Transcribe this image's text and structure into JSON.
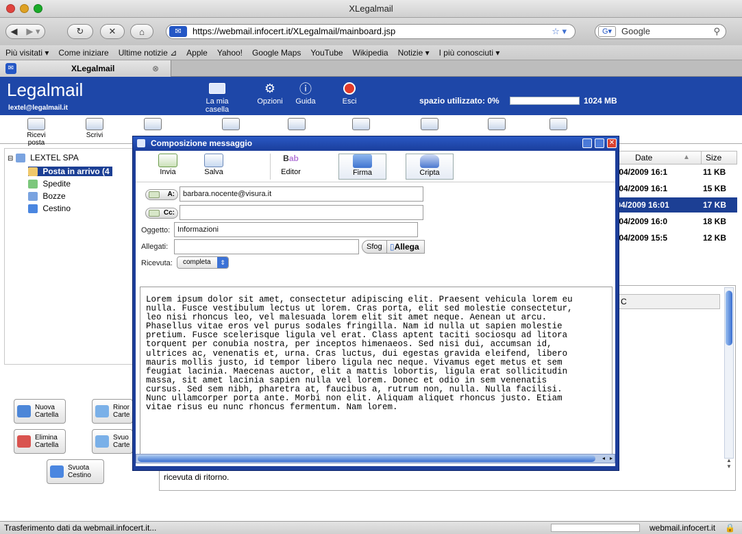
{
  "window": {
    "title": "XLegalmail"
  },
  "browser": {
    "url": "https://webmail.infocert.it/XLegalmail/mainboard.jsp",
    "search_placeholder": "Google",
    "bookmarks": [
      "Più visitati ▾",
      "Come iniziare",
      "Ultime notizie ⊿",
      "Apple",
      "Yahoo!",
      "Google Maps",
      "YouTube",
      "Wikipedia",
      "Notizie ▾",
      "I più conosciuti ▾"
    ],
    "tab_label": "XLegalmail",
    "status_text": "Trasferimento dati da webmail.infocert.it...",
    "status_domain": "webmail.infocert.it"
  },
  "app": {
    "logo": "Legalmail",
    "user": "lextel@legalmail.it",
    "header_buttons": [
      "La mia casella",
      "Opzioni",
      "Guida",
      "Esci"
    ],
    "usage_label": "spazio utilizzato: 0%",
    "usage_fraction": 0.0,
    "usage_max": "1024 MB",
    "toolbar": [
      "Ricevi posta",
      "Scrivi"
    ],
    "tree": {
      "root": "LEXTEL SPA",
      "items": [
        "Posta in arrivo (4",
        "Spedite",
        "Bozze",
        "Cestino"
      ]
    },
    "folder_buttons": {
      "new": [
        "Nuova",
        "Cartella"
      ],
      "rename": [
        "Rinor",
        "Carte"
      ],
      "delete": [
        "Elimina",
        "Cartella"
      ],
      "empty": [
        "Svuo",
        "Carte"
      ],
      "trash": [
        "Svuota",
        "Cestino"
      ]
    },
    "list": {
      "col_date": "Date",
      "col_size": "Size",
      "rows": [
        {
          "date": ")/04/2009 16:1",
          "size": "11 KB"
        },
        {
          "date": ")/04/2009 16:1",
          "size": "15 KB"
        },
        {
          "date": "/04/2009 16:01",
          "size": "17 KB"
        },
        {
          "date": ")/04/2009 16:0",
          "size": "18 KB"
        },
        {
          "date": ")/04/2009 15:5",
          "size": "12 KB"
        }
      ],
      "preview_fragment": "C",
      "preview_bottom": "ricevuta di ritorno."
    }
  },
  "dialog": {
    "title": "Composizione messaggio",
    "buttons": [
      "Invia",
      "Salva",
      "Editor",
      "Firma",
      "Cripta"
    ],
    "to_label": "A:",
    "to_value": "barbara.nocente@visura.it",
    "cc_label": "Cc:",
    "cc_value": "",
    "subject_label": "Oggetto:",
    "subject_value": "Informazioni",
    "attach_label": "Allegati:",
    "browse_label": "Sfog",
    "attach_button": "Allega",
    "receipt_label": "Ricevuta:",
    "receipt_value": "completa",
    "body": "Lorem ipsum dolor sit amet, consectetur adipiscing elit. Praesent vehicula lorem eu\nnulla. Fusce vestibulum lectus ut lorem. Cras porta, elit sed molestie consectetur,\nleo nisi rhoncus leo, vel malesuada lorem elit sit amet neque. Aenean ut arcu.\nPhasellus vitae eros vel purus sodales fringilla. Nam id nulla ut sapien molestie\npretium. Fusce scelerisque ligula vel erat. Class aptent taciti sociosqu ad litora\ntorquent per conubia nostra, per inceptos himenaeos. Sed nisi dui, accumsan id,\nultrices ac, venenatis et, urna. Cras luctus, dui egestas gravida eleifend, libero\nmauris mollis justo, id tempor libero ligula nec neque. Vivamus eget metus et sem\nfeugiat lacinia. Maecenas auctor, elit a mattis lobortis, ligula erat sollicitudin\nmassa, sit amet lacinia sapien nulla vel lorem. Donec et odio in sem venenatis\ncursus. Sed sem nibh, pharetra at, faucibus a, rutrum non, nulla. Nulla facilisi.\nNunc ullamcorper porta ante. Morbi non elit. Aliquam aliquet rhoncus justo. Etiam\nvitae risus eu nunc rhoncus fermentum. Nam lorem."
  },
  "colors": {
    "header_blue": "#1e47a8",
    "dialog_blue": "#1d3e9a",
    "selected_row": "#1c3f94"
  },
  "icons": [
    "back-icon",
    "forward-icon",
    "reload-icon",
    "stop-icon",
    "home-icon",
    "site-icon",
    "star-icon",
    "google-icon",
    "search-icon",
    "mailbox-icon",
    "gear-icon",
    "help-icon",
    "power-icon",
    "lock-icon"
  ]
}
